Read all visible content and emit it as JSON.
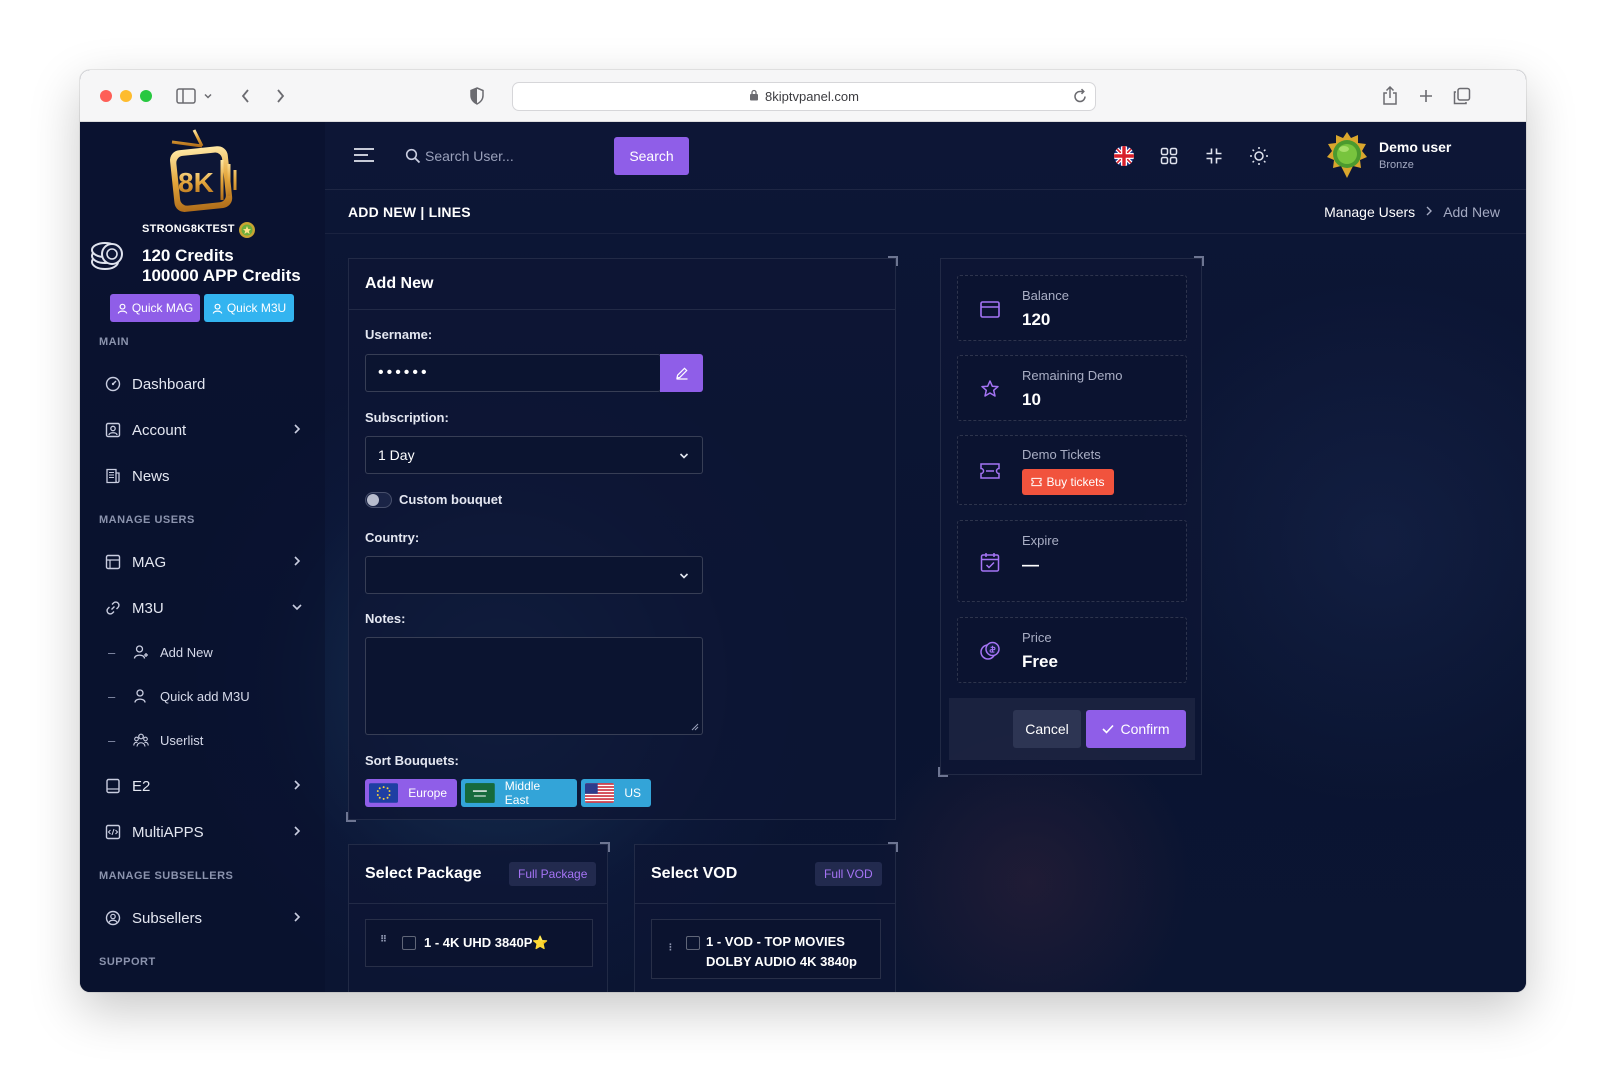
{
  "browser": {
    "url": "8kiptvpanel.com"
  },
  "sidebar": {
    "brand_name": "STRONG8KTEST",
    "credits": "120 Credits",
    "app_credits": "100000 APP Credits",
    "quick_mag": "Quick MAG",
    "quick_m3u": "Quick M3U",
    "sections": {
      "main": "MAIN",
      "manage_users": "MANAGE USERS",
      "manage_subsellers": "MANAGE SUBSELLERS",
      "support": "SUPPORT"
    },
    "items": {
      "dashboard": "Dashboard",
      "account": "Account",
      "news": "News",
      "mag": "MAG",
      "m3u": "M3U",
      "add_new": "Add New",
      "quick_add_m3u": "Quick add M3U",
      "userlist": "Userlist",
      "e2": "E2",
      "multiapps": "MultiAPPS",
      "subsellers": "Subsellers"
    }
  },
  "topbar": {
    "search_placeholder": "Search User...",
    "search_button": "Search",
    "user_name": "Demo user",
    "user_role": "Bronze"
  },
  "page": {
    "title": "ADD NEW | LINES",
    "breadcrumb_parent": "Manage Users",
    "breadcrumb_current": "Add New"
  },
  "form": {
    "card_title": "Add New",
    "username_label": "Username:",
    "username_value": "••••••",
    "subscription_label": "Subscription:",
    "subscription_value": "1 Day",
    "custom_bouquet_label": "Custom bouquet",
    "country_label": "Country:",
    "country_value": "",
    "notes_label": "Notes:",
    "sort_bouquets_label": "Sort Bouquets:",
    "bouquets": [
      "Europe",
      "Middle East",
      "US"
    ]
  },
  "summary": {
    "balance_label": "Balance",
    "balance_value": "120",
    "remaining_demo_label": "Remaining Demo",
    "remaining_demo_value": "10",
    "demo_tickets_label": "Demo Tickets",
    "buy_tickets": "Buy tickets",
    "expire_label": "Expire",
    "expire_value": "—",
    "price_label": "Price",
    "price_value": "Free",
    "cancel": "Cancel",
    "confirm": "Confirm"
  },
  "package": {
    "title": "Select Package",
    "tag": "Full Package",
    "first_item": "1 - 4K UHD 3840P⭐"
  },
  "vod": {
    "title": "Select VOD",
    "tag": "Full VOD",
    "first_item_line1": "1 - VOD - TOP MOVIES",
    "first_item_line2": "DOLBY AUDIO 4K 3840p"
  },
  "colors": {
    "accent": "#8f5ee8",
    "info": "#33b4f0",
    "danger": "#f1533d",
    "background": "#0b1330"
  }
}
